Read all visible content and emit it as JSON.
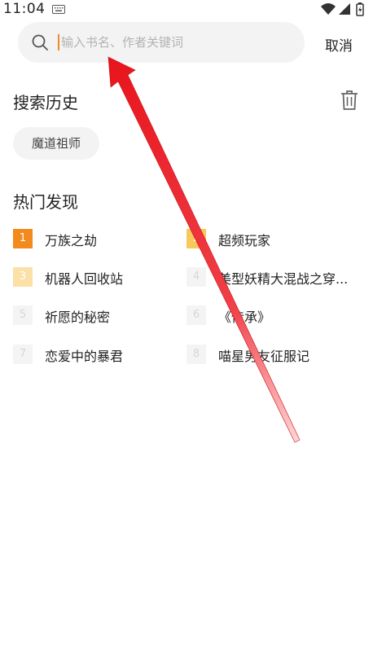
{
  "status_bar": {
    "time": "11:04"
  },
  "search": {
    "placeholder": "输入书名、作者关键词",
    "value": "",
    "cancel_label": "取消"
  },
  "history": {
    "title": "搜索历史",
    "items": [
      "魔道祖师"
    ]
  },
  "hot": {
    "title": "热门发现",
    "items": [
      {
        "rank": "1",
        "name": "万族之劫"
      },
      {
        "rank": "2",
        "name": "超频玩家"
      },
      {
        "rank": "3",
        "name": "机器人回收站"
      },
      {
        "rank": "4",
        "name": "美型妖精大混战之穿..."
      },
      {
        "rank": "5",
        "name": "祈愿的秘密"
      },
      {
        "rank": "6",
        "name": "《传承》"
      },
      {
        "rank": "7",
        "name": "恋爱中的暴君"
      },
      {
        "rank": "8",
        "name": "喵星男友征服记"
      }
    ]
  },
  "colors": {
    "accent": "#f08a20",
    "arrow": "#e8141c"
  }
}
